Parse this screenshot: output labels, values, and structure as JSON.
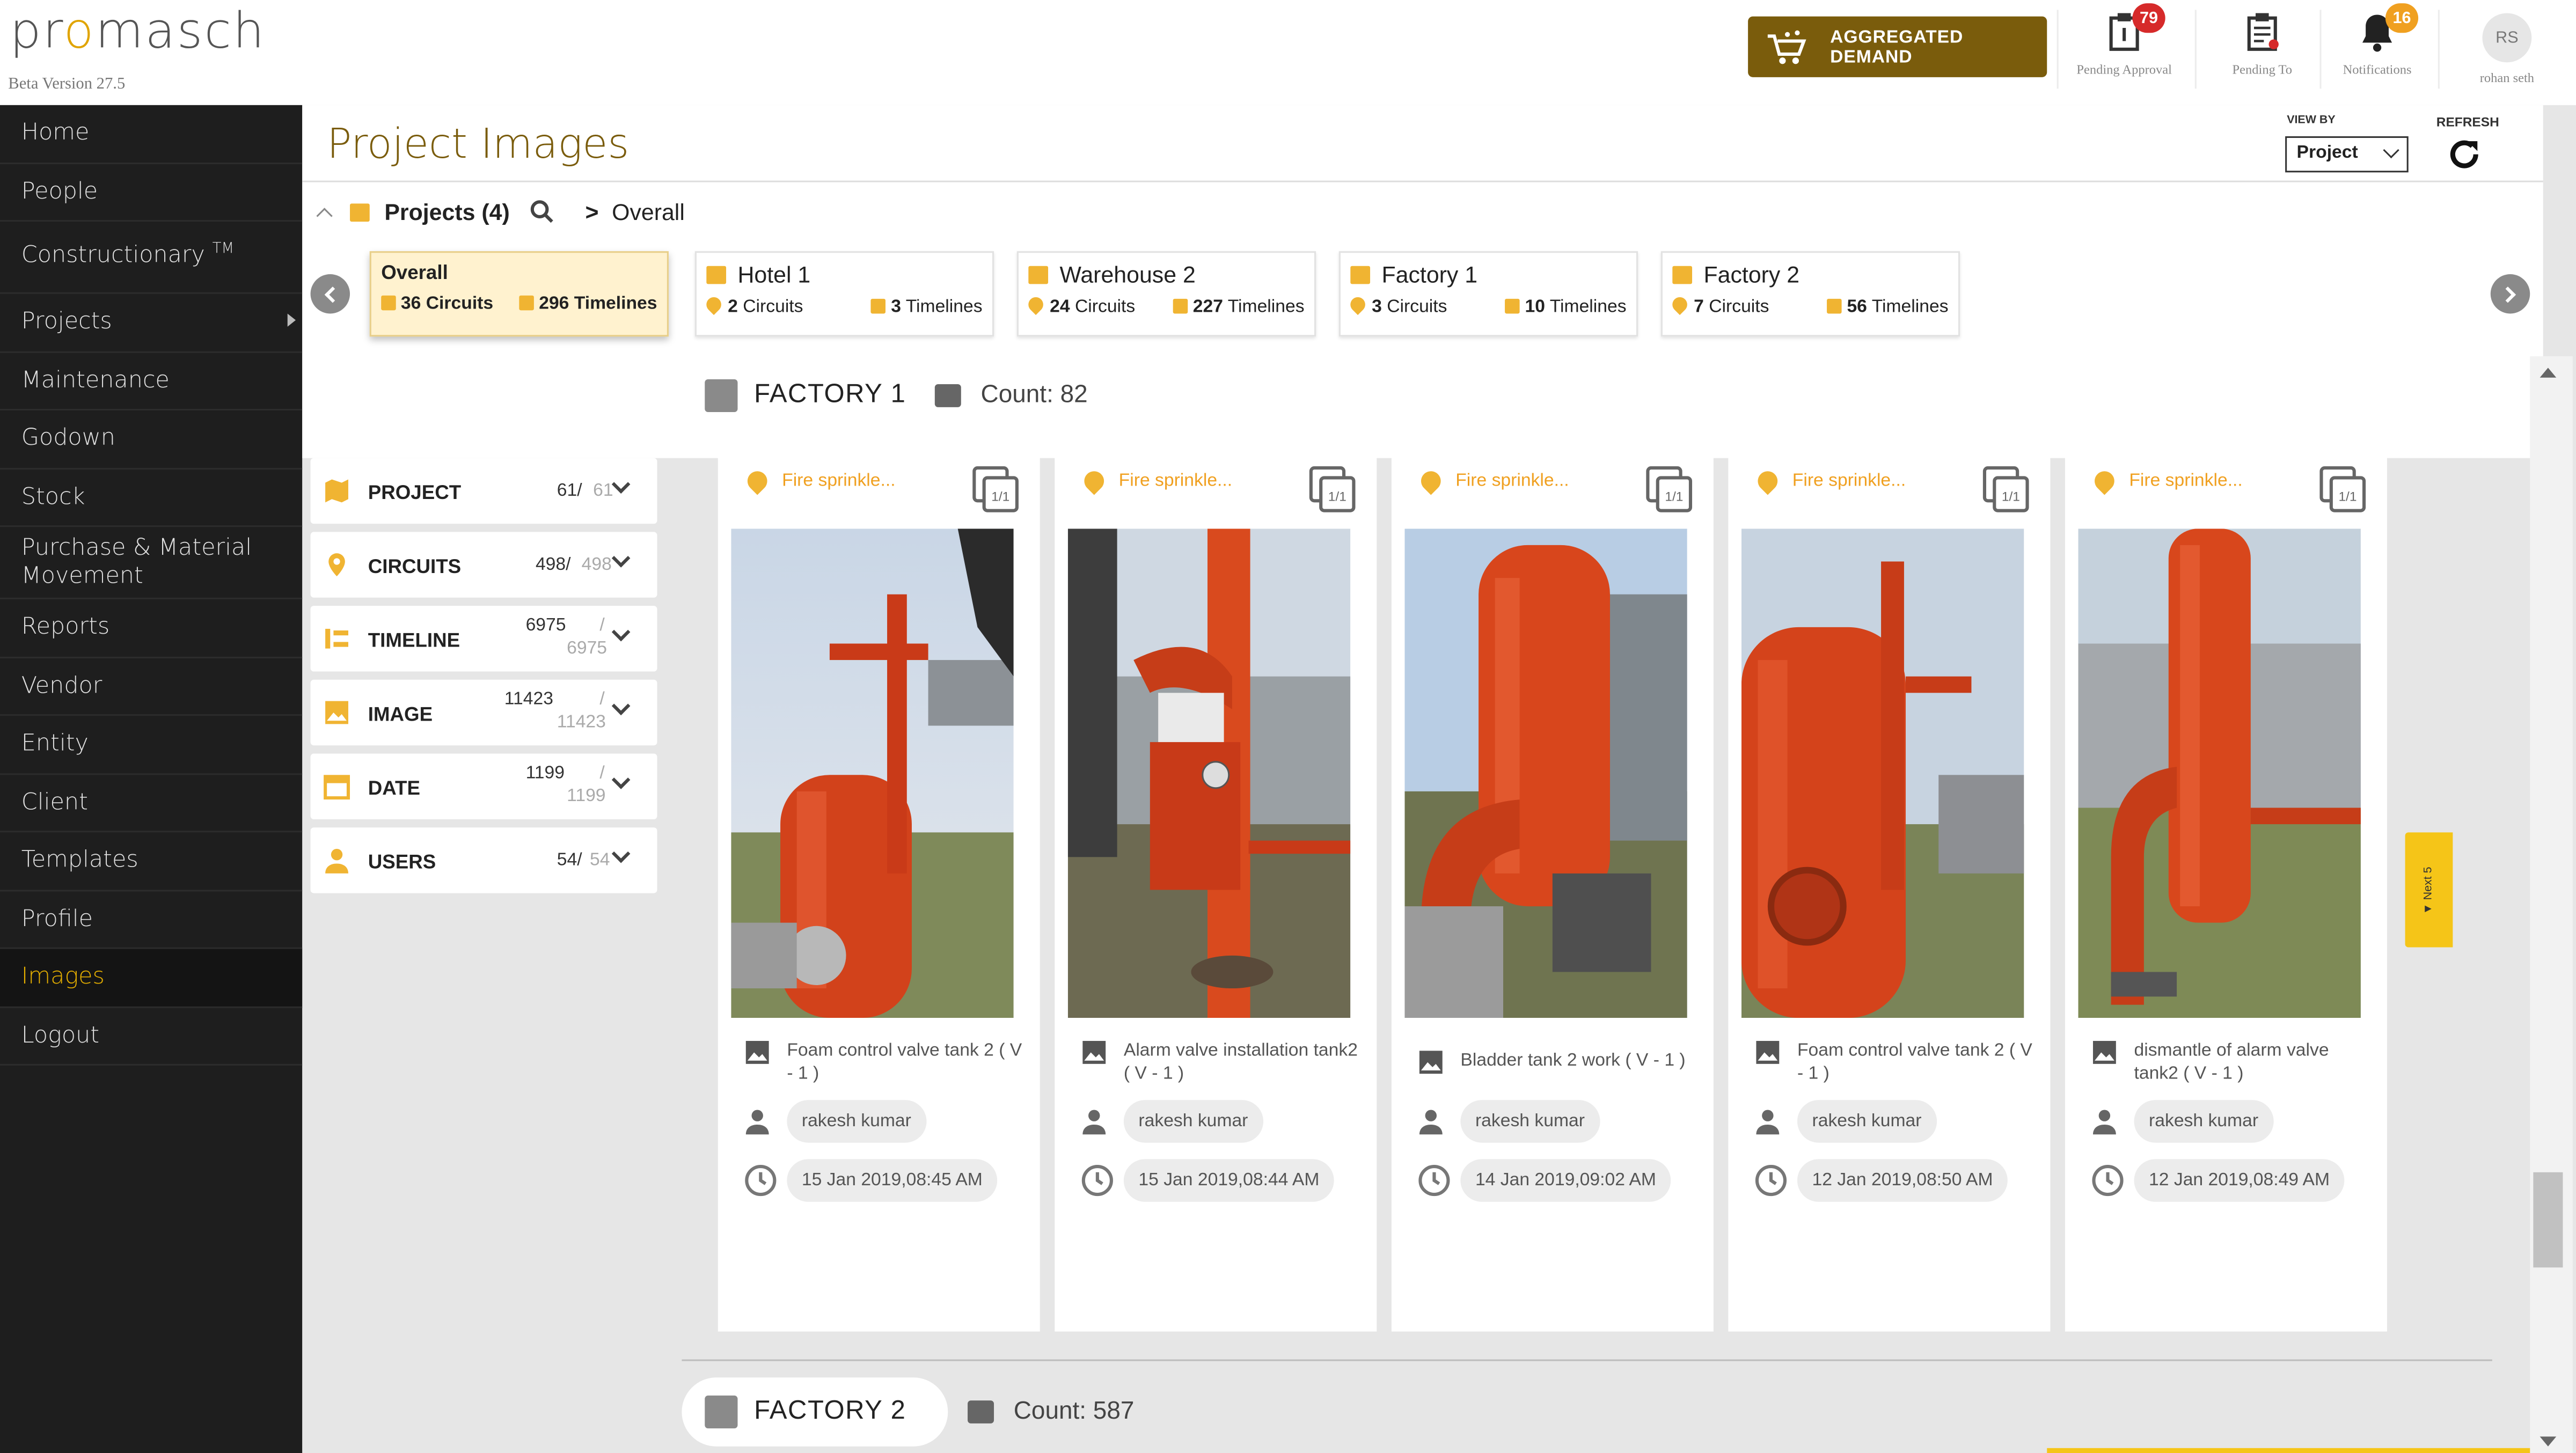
{
  "app": {
    "logo_text_1": "pr",
    "logo_o": "o",
    "logo_text_2": "masch",
    "version": "Beta Version 27.5"
  },
  "header": {
    "aggregated_demand": "AGGREGATED DEMAND",
    "pending_approval": {
      "label": "Pending Approval",
      "count": "79"
    },
    "pending_to": {
      "label": "Pending To"
    },
    "notifications": {
      "label": "Notifications",
      "count": "16"
    },
    "user": {
      "initials": "RS",
      "name": "rohan seth"
    }
  },
  "sidebar": {
    "items": [
      {
        "label": "Home"
      },
      {
        "label": "People"
      },
      {
        "label": "Constructionary",
        "sup": "TM"
      },
      {
        "label": "Projects"
      },
      {
        "label": "Maintenance"
      },
      {
        "label": "Godown"
      },
      {
        "label": "Stock"
      },
      {
        "label": "Purchase & Material Movement"
      },
      {
        "label": "Reports"
      },
      {
        "label": "Vendor"
      },
      {
        "label": "Entity"
      },
      {
        "label": "Client"
      },
      {
        "label": "Templates"
      },
      {
        "label": "Profile"
      },
      {
        "label": "Images"
      },
      {
        "label": "Logout"
      }
    ],
    "active": "Images"
  },
  "page": {
    "title": "Project Images",
    "view_by_label": "VIEW BY",
    "view_by_value": "Project",
    "refresh_label": "REFRESH"
  },
  "projects_bar": {
    "title": "Projects (4)",
    "breadcrumb_current": "Overall",
    "cards": [
      {
        "name": "Overall",
        "circuits": "36 Circuits",
        "timelines": "296 Timelines"
      },
      {
        "name": "Hotel 1",
        "circuits_num": "2",
        "circuits_label": "Circuits",
        "timelines_num": "3",
        "timelines_label": "Timelines"
      },
      {
        "name": "Warehouse 2",
        "circuits_num": "24",
        "circuits_label": "Circuits",
        "timelines_num": "227",
        "timelines_label": "Timelines"
      },
      {
        "name": "Factory 1",
        "circuits_num": "3",
        "circuits_label": "Circuits",
        "timelines_num": "10",
        "timelines_label": "Timelines"
      },
      {
        "name": "Factory 2",
        "circuits_num": "7",
        "circuits_label": "Circuits",
        "timelines_num": "56",
        "timelines_label": "Timelines"
      }
    ]
  },
  "filters": [
    {
      "label": "PROJECT",
      "value": "61/",
      "max": "61"
    },
    {
      "label": "CIRCUITS",
      "value": "498/",
      "max": "498"
    },
    {
      "label": "TIMELINE",
      "value": "6975",
      "sep": "/",
      "max": "6975"
    },
    {
      "label": "IMAGE",
      "value": "11423",
      "sep": "/",
      "max": "11423"
    },
    {
      "label": "DATE",
      "value": "1199",
      "sep": "/",
      "max": "1199"
    },
    {
      "label": "USERS",
      "value": "54/",
      "max": "54"
    }
  ],
  "sections": [
    {
      "name": "FACTORY 1",
      "count": "Count: 82"
    },
    {
      "name": "FACTORY 2",
      "count": "Count: 587"
    }
  ],
  "images": [
    {
      "category": "Fire sprinkle...",
      "page": "1/1",
      "desc": "Foam control valve tank 2 ( V - 1 )",
      "user": "rakesh kumar",
      "time": "15 Jan 2019,08:45 AM"
    },
    {
      "category": "Fire sprinkle...",
      "page": "1/1",
      "desc": "Alarm valve installation tank2 ( V - 1 )",
      "user": "rakesh kumar",
      "time": "15 Jan 2019,08:44 AM"
    },
    {
      "category": "Fire sprinkle...",
      "page": "1/1",
      "desc": "Bladder tank 2 work ( V - 1 )",
      "user": "rakesh kumar",
      "time": "14 Jan 2019,09:02 AM"
    },
    {
      "category": "Fire sprinkle...",
      "page": "1/1",
      "desc": "Foam control valve tank 2 ( V - 1 )",
      "user": "rakesh kumar",
      "time": "12 Jan 2019,08:50 AM"
    },
    {
      "category": "Fire sprinkle...",
      "page": "1/1",
      "desc": "dismantle of alarm valve tank2 ( V - 1 )",
      "user": "rakesh kumar",
      "time": "12 Jan 2019,08:49 AM"
    }
  ],
  "next_tab": "▼ Next 5",
  "colors": {
    "brand": "#7a5c0c",
    "accent": "#f0a020",
    "sidebar_bg": "#1e1e1e",
    "active_nav": "#e7b000"
  }
}
